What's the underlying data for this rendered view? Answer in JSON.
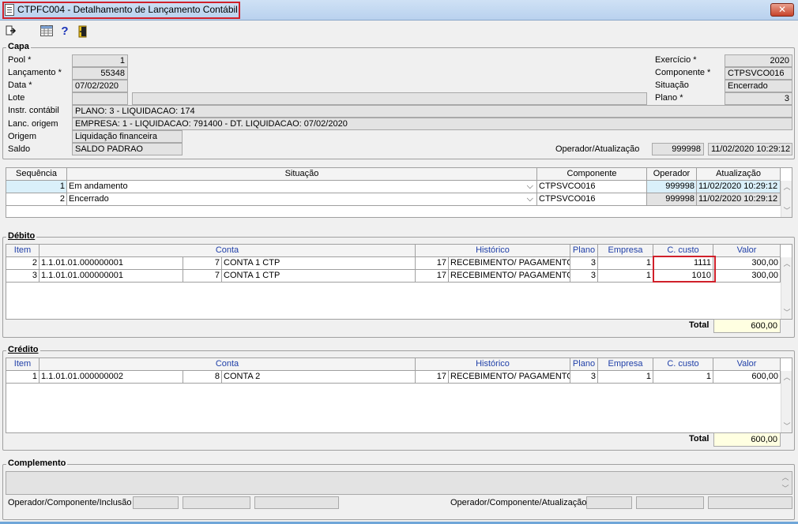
{
  "window": {
    "title": "CTPFC004 - Detalhamento de Lançamento Contábil",
    "close": "✕"
  },
  "capa": {
    "title": "Capa",
    "pool_label": "Pool *",
    "pool": "1",
    "lancamento_label": "Lançamento *",
    "lancamento": "55348",
    "data_label": "Data *",
    "data": "07/02/2020",
    "lote_label": "Lote",
    "lote": "",
    "instr_label": "Instr. contábil",
    "instr": "PLANO: 3 - LIQUIDACAO: 174",
    "lanc_origem_label": "Lanc. origem",
    "lanc_origem": "EMPRESA: 1 - LIQUIDACAO: 791400 - DT. LIQUIDACAO: 07/02/2020",
    "origem_label": "Origem",
    "origem": "Liquidação financeira",
    "saldo_label": "Saldo",
    "saldo": "SALDO PADRAO",
    "exercicio_label": "Exercício *",
    "exercicio": "2020",
    "componente_label": "Componente *",
    "componente": "CTPSVCO016",
    "situacao_label": "Situação",
    "situacao": "Encerrado",
    "plano_label": "Plano *",
    "plano": "3",
    "operador_label": "Operador/Atualização",
    "operador": "999998",
    "atualizacao": "11/02/2020 10:29:12"
  },
  "situacoes": {
    "headers": {
      "sequencia": "Sequência",
      "situacao": "Situação",
      "componente": "Componente",
      "operador": "Operador",
      "atualizacao": "Atualização"
    },
    "rows": [
      {
        "seq": "1",
        "situacao": "Em andamento",
        "componente": "CTPSVCO016",
        "operador": "999998",
        "atualizacao": "11/02/2020 10:29:12"
      },
      {
        "seq": "2",
        "situacao": "Encerrado",
        "componente": "CTPSVCO016",
        "operador": "999998",
        "atualizacao": "11/02/2020 10:29:12"
      }
    ]
  },
  "debito": {
    "title": "Débito",
    "headers": {
      "item": "Item",
      "conta": "Conta",
      "historico": "Histórico",
      "plano": "Plano",
      "empresa": "Empresa",
      "ccusto": "C. custo",
      "valor": "Valor"
    },
    "rows": [
      {
        "item": "2",
        "conta_cod": "1.1.01.01.000000001",
        "conta_num": "7",
        "conta_desc": "CONTA 1 CTP",
        "hist_num": "17",
        "hist_desc": "RECEBIMENTO/ PAGAMENTO",
        "plano": "3",
        "empresa": "1",
        "ccusto": "1111",
        "valor": "300,00"
      },
      {
        "item": "3",
        "conta_cod": "1.1.01.01.000000001",
        "conta_num": "7",
        "conta_desc": "CONTA 1 CTP",
        "hist_num": "17",
        "hist_desc": "RECEBIMENTO/ PAGAMENTO",
        "plano": "3",
        "empresa": "1",
        "ccusto": "1010",
        "valor": "300,00"
      }
    ],
    "total_label": "Total",
    "total": "600,00"
  },
  "credito": {
    "title": "Crédito",
    "headers": {
      "item": "Item",
      "conta": "Conta",
      "historico": "Histórico",
      "plano": "Plano",
      "empresa": "Empresa",
      "ccusto": "C. custo",
      "valor": "Valor"
    },
    "rows": [
      {
        "item": "1",
        "conta_cod": "1.1.01.01.000000002",
        "conta_num": "8",
        "conta_desc": "CONTA 2",
        "hist_num": "17",
        "hist_desc": "RECEBIMENTO/ PAGAMENTO",
        "plano": "3",
        "empresa": "1",
        "ccusto": "1",
        "valor": "600,00"
      }
    ],
    "total_label": "Total",
    "total": "600,00"
  },
  "complemento": {
    "title": "Complemento",
    "inclusao_label": "Operador/Componente/Inclusão",
    "atualizacao_label": "Operador/Componente/Atualização"
  },
  "icons": {
    "exit": "exit-icon",
    "grid": "grid-icon",
    "help": "help-icon",
    "door": "door-icon"
  },
  "colors": {
    "highlight": "#d0202a",
    "header_text": "#1f3fa8",
    "selected_row": "#daf0fa",
    "total_bg": "#ffffe1"
  }
}
